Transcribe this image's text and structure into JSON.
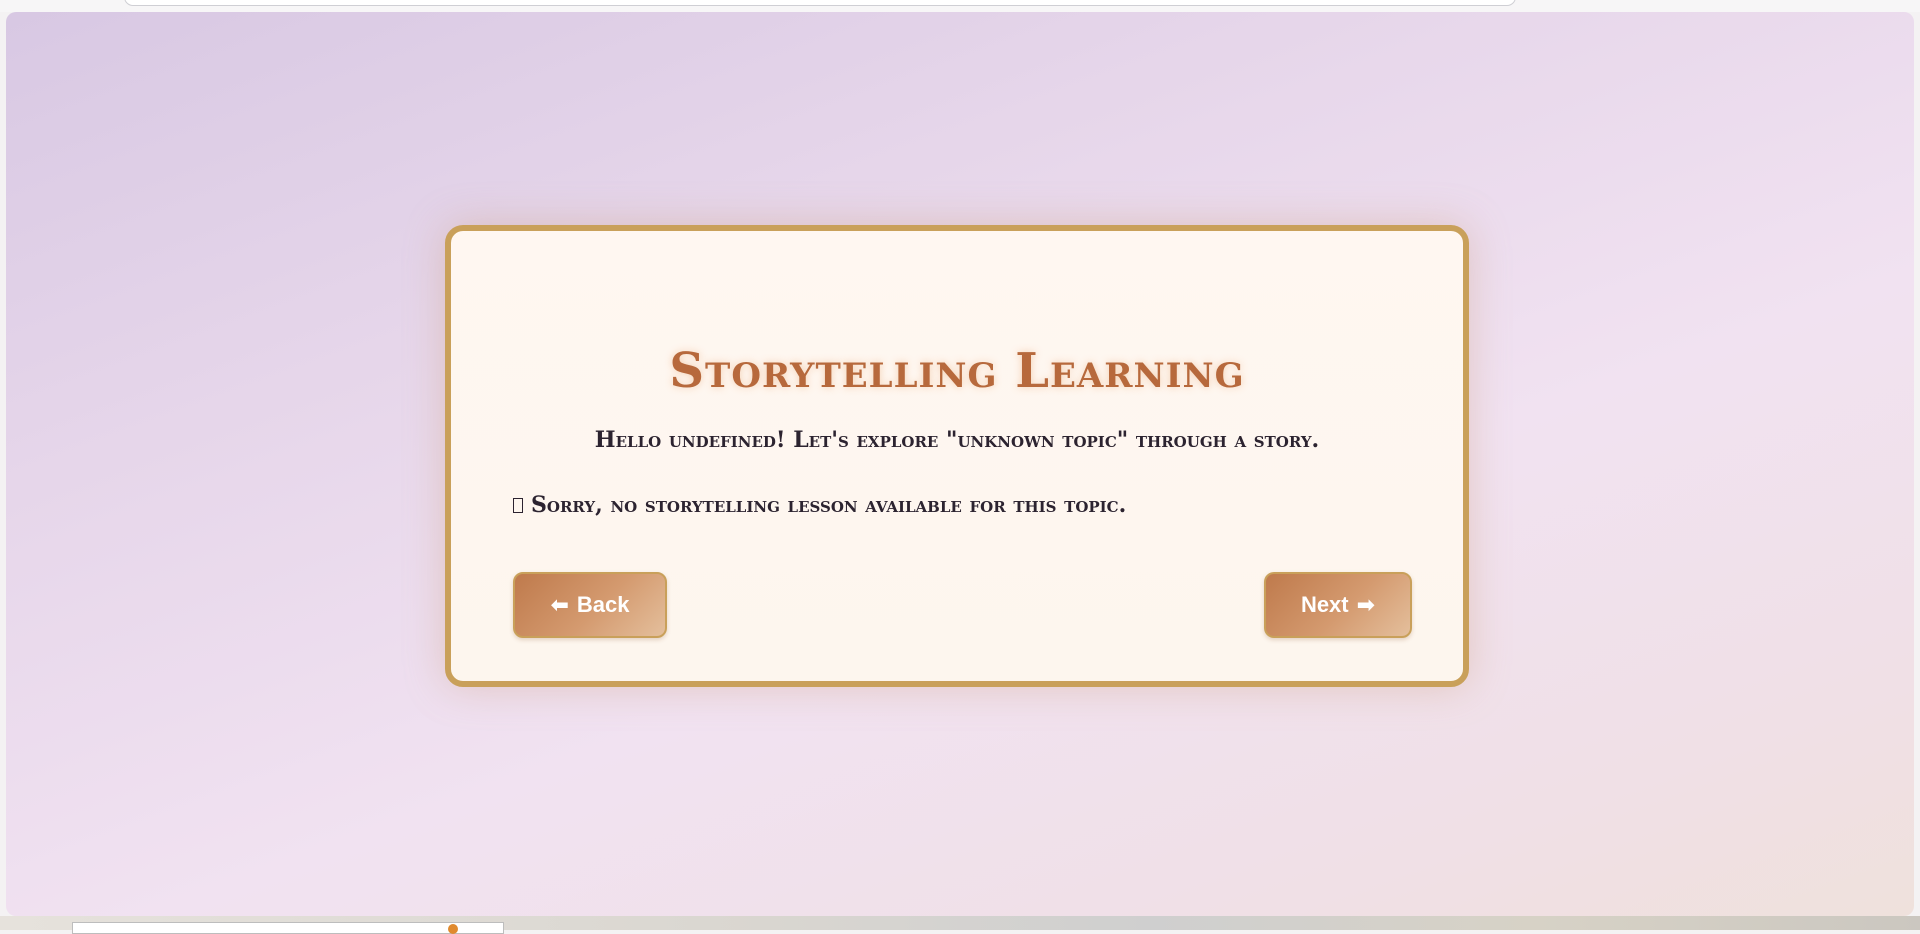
{
  "lesson": {
    "title": "Storytelling Learning",
    "greeting": "Hello undefined! Let's explore \"unknown topic\" through a story.",
    "message": "Sorry, no storytelling lesson available for this topic."
  },
  "navigation": {
    "back_arrow": "⬅",
    "back_label": "Back",
    "next_label": "Next",
    "next_arrow": "➡"
  },
  "colors": {
    "accent": "#b7693c",
    "border": "#c9a05a",
    "button_start": "#bf7a4c",
    "button_end": "#e4bf9c",
    "card_background": "#fff7f1"
  }
}
